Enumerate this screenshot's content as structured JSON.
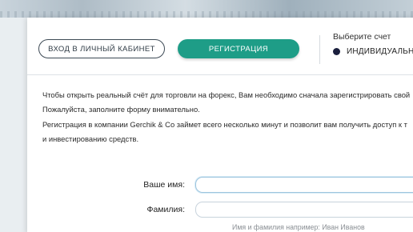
{
  "auth": {
    "login_label": "ВХОД В ЛИЧНЫЙ КАБИНЕТ",
    "register_label": "РЕГИСТРАЦИЯ"
  },
  "account": {
    "title": "Выберите счет",
    "selected_option": "ИНДИВИДУАЛЬНЫ"
  },
  "intro": {
    "line1": "Чтобы открыть реальный счёт для торговли на форекс, Вам необходимо сначала зарегистрировать свой",
    "line2": "Пожалуйста, заполните форму внимательно.",
    "line3": "Регистрация в компании Gerchik & Co займет всего несколько минут и позволит вам получить доступ к т",
    "line4": "и инвестированию средств."
  },
  "form": {
    "first_name_label": "Ваше имя:",
    "first_name_value": "",
    "last_name_label": "Фамилия:",
    "last_name_value": "",
    "name_hint": "Имя и фамилия например: Иван Иванов"
  },
  "colors": {
    "accent": "#1e9d87",
    "radio": "#1a1f3d"
  }
}
